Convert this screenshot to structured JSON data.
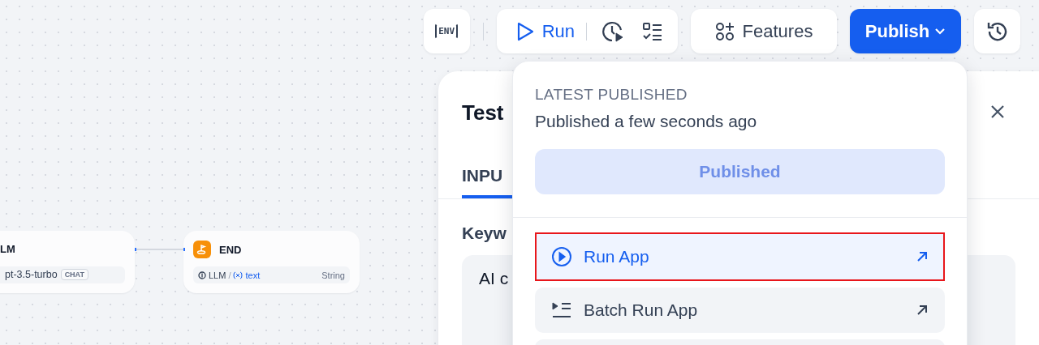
{
  "canvas": {
    "nodes": [
      {
        "kind": "llm",
        "title": "LM",
        "model": "pt-3.5-turbo",
        "mode_tag": "CHAT"
      },
      {
        "kind": "end",
        "title": "END",
        "source": "LLM",
        "separator": "/",
        "variable": "text",
        "type": "String"
      }
    ]
  },
  "toolbar": {
    "env_label": "ENV",
    "run_label": "Run",
    "features_label": "Features",
    "publish_label": "Publish"
  },
  "test_panel": {
    "title": "Test",
    "tabs": [
      {
        "label": "INPU",
        "selected": true
      }
    ],
    "field_label": "Keyw",
    "field_value": "AI c"
  },
  "publish_menu": {
    "heading": "LATEST PUBLISHED",
    "status": "Published a few seconds ago",
    "publish_button": {
      "label": "Published",
      "disabled": true
    },
    "items": [
      {
        "kind": "run",
        "label": "Run App",
        "selected": true,
        "highlighted": true
      },
      {
        "kind": "batch",
        "label": "Batch Run App",
        "selected": false,
        "highlighted": false
      }
    ]
  }
}
